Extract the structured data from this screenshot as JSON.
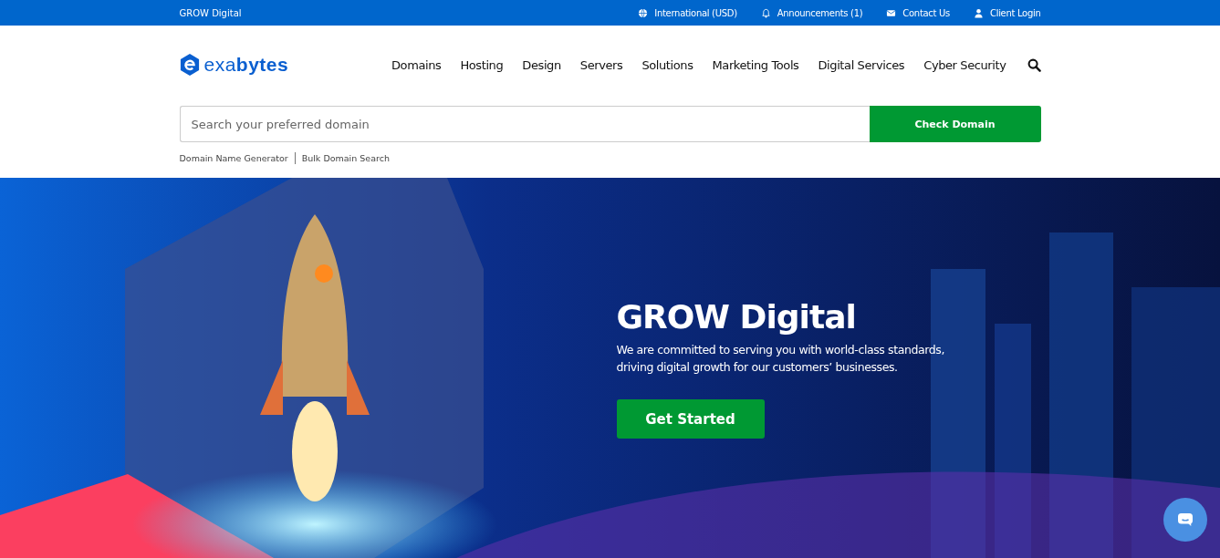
{
  "top_bar": {
    "brand": "GROW Digital",
    "links": [
      {
        "kind": "globe",
        "label": "International (USD)"
      },
      {
        "kind": "bell",
        "label": "Announcements (1)"
      },
      {
        "kind": "mail",
        "label": "Contact Us"
      },
      {
        "kind": "user",
        "label": "Client Login"
      }
    ]
  },
  "header": {
    "logo": "exa**bytes**",
    "nav": [
      "Domains",
      "Hosting",
      "Design",
      "Servers",
      "Solutions",
      "Marketing Tools",
      "Digital Services",
      "Cyber Security"
    ]
  },
  "domain_search": {
    "placeholder": "Search your preferred domain",
    "button": "Check Domain",
    "links": [
      "Domain Name Generator",
      "Bulk Domain Search"
    ]
  },
  "hero": {
    "kind": "picture",
    "title": "GROW Digital",
    "text": "We are committed to serving you with world-class standards, driving digital growth for our customers’ businesses.",
    "button": "Get Started"
  }
}
